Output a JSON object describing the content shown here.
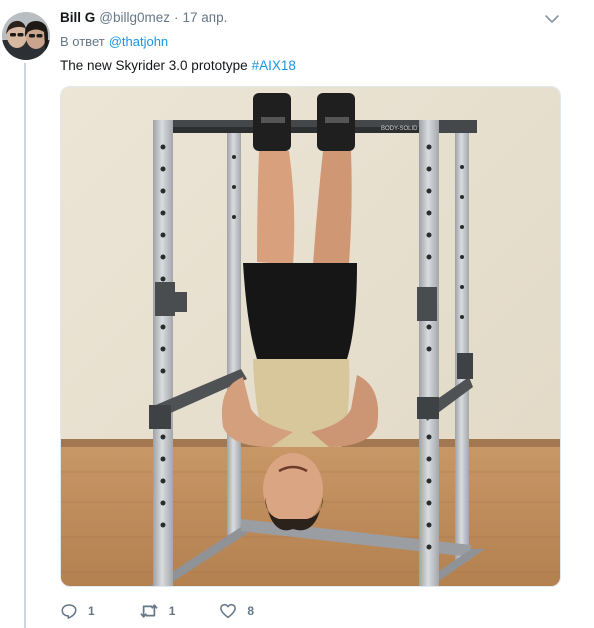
{
  "tweet": {
    "author_name": "Bill G",
    "author_handle": "@billg0mez",
    "separator": "·",
    "timestamp": "17 апр.",
    "reply_prefix": "В ответ",
    "reply_mention": "@thatjohn",
    "text": "The new Skyrider 3.0 prototype",
    "hashtag": "#AIX18",
    "image_brand_text": "BODY-SOLID"
  },
  "actions": {
    "reply_count": "1",
    "retweet_count": "1",
    "like_count": "8"
  },
  "colors": {
    "link": "#1b95e0",
    "secondary_text": "#657786",
    "primary_text": "#14171a",
    "thread_line": "#ccd6dd"
  },
  "icons": [
    "chevron-down-icon",
    "reply-icon",
    "retweet-icon",
    "like-icon"
  ]
}
